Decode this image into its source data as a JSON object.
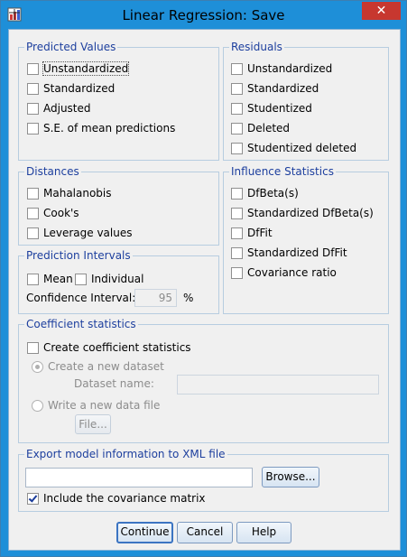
{
  "window": {
    "title": "Linear Regression: Save",
    "close_glyph": "✕",
    "icon": "spss-app-icon"
  },
  "predicted_values": {
    "legend": "Predicted Values",
    "items": [
      {
        "label": "Unstandardized",
        "checked": false
      },
      {
        "label": "Standardized",
        "checked": false
      },
      {
        "label": "Adjusted",
        "checked": false
      },
      {
        "label": "S.E. of mean predictions",
        "checked": false
      }
    ]
  },
  "residuals": {
    "legend": "Residuals",
    "items": [
      {
        "label": "Unstandardized",
        "checked": false
      },
      {
        "label": "Standardized",
        "checked": false
      },
      {
        "label": "Studentized",
        "checked": false
      },
      {
        "label": "Deleted",
        "checked": false
      },
      {
        "label": "Studentized deleted",
        "checked": false
      }
    ]
  },
  "distances": {
    "legend": "Distances",
    "items": [
      {
        "label": "Mahalanobis",
        "checked": false
      },
      {
        "label": "Cook's",
        "checked": false
      },
      {
        "label": "Leverage values",
        "checked": false
      }
    ]
  },
  "influence": {
    "legend": "Influence Statistics",
    "items": [
      {
        "label": "DfBeta(s)",
        "checked": false
      },
      {
        "label": "Standardized DfBeta(s)",
        "checked": false
      },
      {
        "label": "DfFit",
        "checked": false
      },
      {
        "label": "Standardized DfFit",
        "checked": false
      },
      {
        "label": "Covariance ratio",
        "checked": false
      }
    ]
  },
  "prediction_intervals": {
    "legend": "Prediction Intervals",
    "mean_label": "Mean",
    "individual_label": "Individual",
    "ci_label": "Confidence Interval:",
    "ci_value": "95",
    "ci_unit": "%"
  },
  "coefficient": {
    "legend": "Coefficient statistics",
    "create_label": "Create coefficient statistics",
    "new_dataset_label": "Create a new dataset",
    "dataset_name_label": "Dataset name:",
    "dataset_name_value": "",
    "write_file_label": "Write a new data file",
    "file_button": "File..."
  },
  "export": {
    "legend": "Export model information to XML file",
    "path_value": "",
    "browse_button": "Browse...",
    "covariance_label": "Include the covariance matrix",
    "covariance_checked": true
  },
  "buttons": {
    "continue": "Continue",
    "cancel": "Cancel",
    "help": "Help"
  }
}
